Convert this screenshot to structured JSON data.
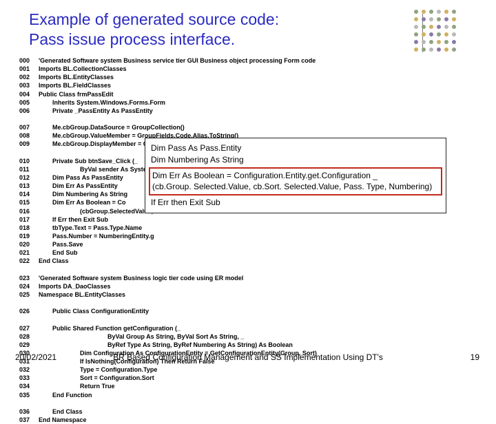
{
  "title_line1": "Example of generated source code:",
  "title_line2": "Pass issue process interface.",
  "code": {
    "l00": "'Generated Software system Business service tier GUI Business object processing Form code",
    "l01": "Imports BL.CollectionClasses",
    "l02": "Imports BL.EntityClasses",
    "l03": "Imports BL.FieldClasses",
    "l04": "Public Class frmPassEdit",
    "l05": "Inherits System.Windows.Forms.Form",
    "l06": "Private _PassEntity As PassEntity",
    "l07": "Me.cbGroup.DataSource = GroupCollection()",
    "l08": "Me.cbGroup.ValueMember = GroupFields.Code.Alias.ToString()",
    "l09": "Me.cbGroup.DisplayMember = GroupFields.Name.Alias.ToString()",
    "l10": "Private Sub btnSave_Click (_",
    "l11": "ByVal sender As System.O",
    "l12": "Dim Pass As PassEntity",
    "l13": "Dim Err As PassEntity",
    "l14": "Dim Numbering As String",
    "l15": "Dim Err As Boolean = Co",
    "l16": "(cbGroup.SelectedValue, cb",
    "l17": "If Err then Exit Sub",
    "l18": "tbType.Text = Pass.Type.Name",
    "l19": "Pass.Number = NumberingEntity.g",
    "l20": "Pass.Save",
    "l21": "End Sub",
    "l22": "End Class",
    "l23": "'Generated Software system Business logic tier code using ER model",
    "l24": "Imports DA_DaoClasses",
    "l25": "Namespace BL.EntityClasses",
    "l26": "Public Class ConfigurationEntity",
    "l27": "Public Shared Function getConfiguration (_",
    "l28": "ByVal Group As String, ByVal Sort As String, _",
    "l29": "ByRef Type As String, ByRef Numbering As String) As Boolean",
    "l30": "Dim Configuration As ConfigurationEntity = GetConfigurationEntity(Group, Sort)",
    "l31": "If IsNothing(Configuration) Then Return False",
    "l32": "Type = Configuration.Type",
    "l33": "Sort = Configuration.Sort",
    "l34": "Return True",
    "l35": "End Function",
    "l36": "End Class",
    "l37": "End Namespace"
  },
  "callout": {
    "r1": "Dim Pass As Pass.Entity",
    "r2": "Dim Numbering As String",
    "r3": "Dim Err As Boolean = Configuration.Entity.get.Configuration _",
    "r4": "(cb.Group. Selected.Value, cb.Sort. Selected.Value, Pass. Type, Numbering)",
    "r5": "If Err then Exit Sub"
  },
  "footer": {
    "date": "20/02/2021",
    "title": "BR Based Configuration Management and SS Implementation Using DT's",
    "page": "19"
  }
}
